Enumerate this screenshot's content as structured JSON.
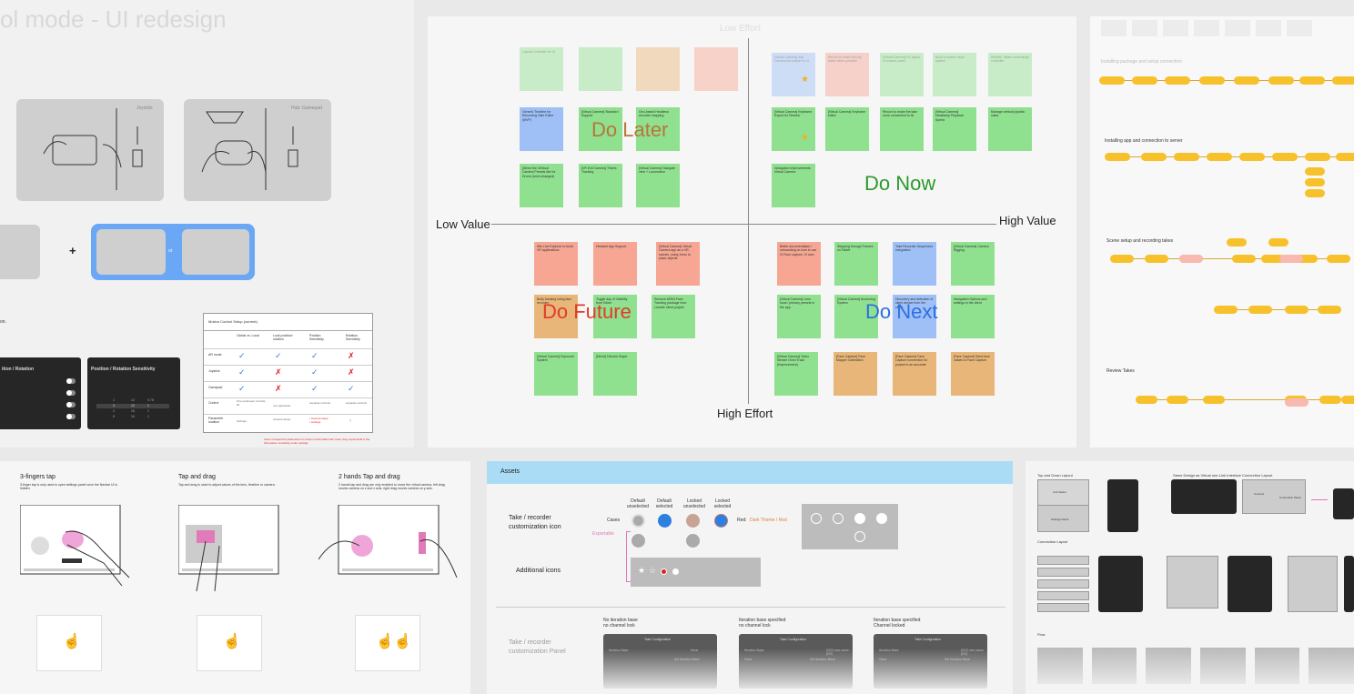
{
  "frames": {
    "tool_mode": {
      "title": "ol mode - UI redesign",
      "illus_labels": [
        "Joystick",
        "Hub: Gamepad"
      ],
      "small_note": "on.",
      "panel1_title": "ition / Rotation",
      "panel2_title": "Position / Rotation Sensitivity",
      "panel2_rows": [
        [
          "1",
          "12",
          "0.75"
        ],
        [
          "4",
          "12",
          "1"
        ],
        [
          "4",
          "16",
          "1"
        ],
        [
          "5",
          "16",
          "1"
        ]
      ],
      "table": {
        "title": "Motion Control Setup (current)",
        "headers": [
          "Global vs. Local",
          "Look position/ rotation",
          "Position Sensitivity",
          "Rotation Sensitivity"
        ],
        "rows": [
          {
            "label": "AR mode",
            "cells": [
              "✓",
              "✓",
              "✓",
              "✗"
            ]
          },
          {
            "label": "Joystick",
            "cells": [
              "✓",
              "✗",
              "✓",
              "✗"
            ]
          },
          {
            "label": "Gamepad",
            "cells": [
              "✓",
              "✗",
              "✓",
              "✓"
            ]
          },
          {
            "label": "Control",
            "cells": [
              "One parameter controls all",
              "one parameter",
              "separate controls",
              "separate controls"
            ]
          },
          {
            "label": "Parameter location",
            "cells": [
              "Settings",
              "Camera Setup",
              "• Camera setup\n• settings",
              "?"
            ]
          }
        ],
        "footnote": "Users misspell the parameters to motion control affect AR mode; they expect field in the full position sensitivity under settings"
      },
      "plus": "+",
      "or": "or"
    },
    "matrix": {
      "top_label": "Low Effort",
      "bottom_label": "High Effort",
      "left_label": "Low Value",
      "right_label": "High Value",
      "quadrants": {
        "do_later": "Do Later",
        "do_now": "Do Now",
        "do_future": "Do Future",
        "do_next": "Do Next"
      },
      "stickies": [
        {
          "color": "g",
          "text": "Layout Controller for UI",
          "faded": true
        },
        {
          "color": "g",
          "text": "",
          "faded": true
        },
        {
          "color": "o",
          "text": "",
          "faded": true
        },
        {
          "color": "r",
          "text": "",
          "faded": true
        },
        {
          "color": "b",
          "text": "[Virtual Camera] Add Camera list toolbar to UI",
          "faded": true
        },
        {
          "color": "r",
          "text": "Record to make the clip faster when possible",
          "faded": true
        },
        {
          "color": "g",
          "text": "[Virtual Camera] Fix layout of custom panel",
          "faded": true
        },
        {
          "color": "g",
          "text": "Build a custom input system",
          "faded": true
        },
        {
          "color": "g",
          "text": "Refresh Takes connectivity controller",
          "faded": true
        },
        {
          "color": "b",
          "text": "Generic Timeline for Recording Take Editor (MVP)"
        },
        {
          "color": "g",
          "text": "[Virtual Camera] Standard Support"
        },
        {
          "color": "g",
          "text": "Geo-based Headless recorder mapping"
        },
        {
          "color": "g",
          "text": "[Virtual Camera] Keyframe Export for Director"
        },
        {
          "color": "g",
          "text": "[Virtual Camera] Keyframe editor"
        },
        {
          "color": "g",
          "text": "Record to make the take more convenient to fix"
        },
        {
          "color": "g",
          "text": "[Virtual Camera] Headlamp Playback Speed"
        },
        {
          "color": "g",
          "text": "Manage vertical joystick value"
        },
        {
          "color": "g",
          "text": "Navigation Improvements Virtual Camera"
        },
        {
          "color": "g",
          "text": "[Direct the 3Virtual Camera Presets like for Drone (Anim changed)"
        },
        {
          "color": "g",
          "text": "[VR Exit Camera] Timers Tracking"
        },
        {
          "color": "g",
          "text": "[Virtual Camera] Navigate view + Locomotion"
        },
        {
          "color": "r",
          "text": "Win Live Explorer to build VR applications"
        },
        {
          "color": "r",
          "text": "Headset App Support"
        },
        {
          "color": "r",
          "text": "[Virtual Camera] Virtual Camera app as a VR scenes, using Jomo to place objects"
        },
        {
          "color": "r",
          "text": "Better documentation / onboarding on how to use VI Face capture, VI cam"
        },
        {
          "color": "g",
          "text": "Stepping through Frames on Tablet"
        },
        {
          "color": "b",
          "text": "Take Recorder Sequences Integration"
        },
        {
          "color": "g",
          "text": "[Virtual Camera] Camera Rigging"
        },
        {
          "color": "o",
          "text": "Body tracking using face recorder"
        },
        {
          "color": "g",
          "text": "Toggle day of Visibility from Editor"
        },
        {
          "color": "g",
          "text": "Remove ARKit Face Tracking package from Livesite client project"
        },
        {
          "color": "g",
          "text": "[Virtual Camera] Lens focal / primary presets in the app"
        },
        {
          "color": "g",
          "text": "[Virtual Camera] Anchoring System"
        },
        {
          "color": "b",
          "text": "Discovery and detection of client device from the client"
        },
        {
          "color": "g",
          "text": "Navigation Options and settings in the client"
        },
        {
          "color": "g",
          "text": "[Virtual Camera] Exposure System"
        },
        {
          "color": "g",
          "text": "[Direct] Director Buyer"
        },
        {
          "color": "g",
          "text": "[Virtual Camera] Video Stream Omni Track (Improvement)"
        },
        {
          "color": "o",
          "text": "[Face Capture] Face Mapper Calibration"
        },
        {
          "color": "o",
          "text": "[Face Capture] Face Capture connection for project to an accurate"
        },
        {
          "color": "o",
          "text": "[Face Capture] Send face values to Face Capture"
        }
      ]
    },
    "flow": {
      "sections": [
        "Installing package and setup connection",
        "Installing app and connection to server",
        "Scene setup and recording takes",
        "Review Takes"
      ]
    },
    "gestures": {
      "items": [
        {
          "title": "3-fingers tap",
          "desc": "3-finger tap is only used to open settings panel once the Navbar UI is hidden."
        },
        {
          "title": "Tap and drag",
          "desc": "Tap and drag is used to adjust values of the lens, timeline or camera."
        },
        {
          "title": "2 hands Tap and drag",
          "desc": "2 hands tap and drag are only enabled to move the virtual camera, left drag moves camera on z and x axis, right drag moves camera on y axis."
        }
      ]
    },
    "assets": {
      "header": "Assets",
      "row1_label": "Take / recorder customization icon",
      "cases_label": "Cases",
      "states": [
        "Default unselected",
        "Default selected",
        "Locked unselected",
        "Locked selected"
      ],
      "red_note_prefix": "Red:",
      "red_note_value": "Dark Theme / Red",
      "exportable": "Exportable",
      "row2_label": "Additional icons",
      "row3_label": "Take / recorder customization Panel",
      "panels": [
        {
          "caption": "No iteration base\nno channel lock",
          "title": "Take Configuration",
          "field1": "Iteration Base",
          "value1": "None",
          "field2": "",
          "value2": "Set iteration Base"
        },
        {
          "caption": "Iteration base specified\nno channel lock",
          "title": "Take Configuration",
          "field1": "Iteration Base",
          "value1": "[002] new name (ER)",
          "field2": "Clear",
          "value2": "Set Iteration Base"
        },
        {
          "caption": "Iteration base specified\nChannel locked",
          "title": "Take Configuration",
          "field1": "Iteration Base",
          "value1": "[002] new name (ER)",
          "field2": "Clear",
          "value2": "Set Iteration Base"
        }
      ]
    },
    "layouts": {
      "top_label": "Top and Down Layout",
      "mid_label": "Same Design as Virtual one-Link Interface   Connection Layout",
      "conn_label": "Connection Layout",
      "box_labels": [
        "Link Status",
        "Settings Panel",
        "Connect",
        "Connection Panel"
      ],
      "flow_label": "Flow"
    },
    "colors": {
      "accent_blue": "#6aa7f5",
      "assets_header": "#aadcf6",
      "sticky_green": "#8fe08f",
      "sticky_red": "#f6a693",
      "sticky_blue": "#9fc0f7",
      "sticky_orange": "#e8b678",
      "flow_yellow": "#f6c12b",
      "do_later": "#b8763a",
      "do_now": "#2c9a2c",
      "do_future": "#e23b2a",
      "do_next": "#2d6fe0"
    }
  }
}
